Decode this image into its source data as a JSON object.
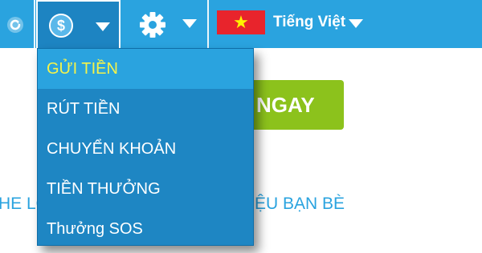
{
  "topbar": {
    "refresh_icon": "refresh-icon",
    "money_icon": "dollar-coin-icon",
    "money_symbol": "$",
    "settings_icon": "gear-icon",
    "language": {
      "flag": "vietnam-flag-icon",
      "flag_star": "★",
      "label": "Tiếng Việt"
    }
  },
  "dropdown": {
    "items": [
      {
        "label": "GỬI TIỀN"
      },
      {
        "label": "RÚT TIỀN"
      },
      {
        "label": "CHUYỂN KHOẢN"
      },
      {
        "label": "TIỀN THƯỞNG"
      },
      {
        "label": "Thưởng SOS"
      }
    ],
    "active_color": "#f5f34a"
  },
  "background": {
    "button_label": "NGAY",
    "left_text": "HE LO",
    "right_text": "ỆU BẠN BÈ"
  },
  "colors": {
    "topbar": "#2aa3df",
    "menu": "#1e86c3",
    "green_button": "#8cc21c",
    "flag_red": "#e8242c",
    "flag_star": "#fff200"
  }
}
